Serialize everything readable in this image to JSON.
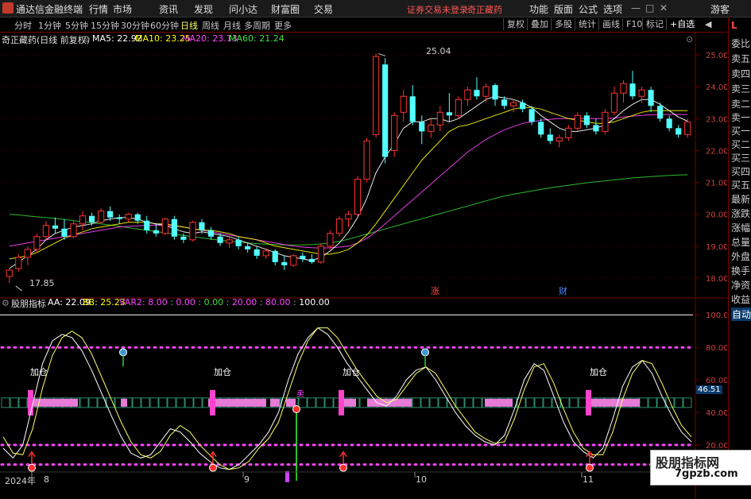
{
  "menubar": {
    "app_title": "通达信金融终端",
    "menus": [
      "行情",
      "市场",
      "资讯",
      "发现",
      "问小达",
      "财富圈",
      "交易"
    ],
    "alert_text": "证券交易未登录",
    "stock_name": "奇正藏药",
    "right_items": [
      "功能",
      "版面",
      "公式",
      "选项"
    ],
    "guest": "游客",
    "window_controls": [
      "—",
      "□",
      "✕"
    ]
  },
  "toolbar": {
    "tabs": [
      "分时",
      "1分钟",
      "5分钟",
      "15分钟",
      "30分钟",
      "60分钟",
      "日线",
      "周线",
      "月线",
      "多周期",
      "更多"
    ],
    "active_tab": "日线",
    "buttons": [
      "复权",
      "叠加",
      "多股",
      "统计",
      "画线",
      "F10",
      "标记",
      "+自选"
    ],
    "back_button": "◀"
  },
  "right_panel": {
    "top": "L",
    "items": [
      "委比",
      "卖五",
      "卖四",
      "卖三",
      "卖二",
      "卖一",
      "买一",
      "买二",
      "买三",
      "买四",
      "买五",
      "最新",
      "涨跌",
      "涨幅",
      "总量",
      "外盘",
      "换手",
      "净资",
      "收益"
    ],
    "auto_label": "自动"
  },
  "main_chart": {
    "title": "奇正藏药(日线 前复权)",
    "ma_labels": [
      {
        "label": "MA5: 22.92",
        "color": "#ffffff"
      },
      {
        "label": "MA10: 23.25",
        "color": "#ffff00"
      },
      {
        "label": "MA20: 23.13",
        "color": "#ff44ff"
      },
      {
        "label": "MA60: 21.24",
        "color": "#44dd44"
      }
    ],
    "high_label": "25.04",
    "low_label": "17.85",
    "marks": [
      {
        "text": "涨",
        "color": "#ff4444"
      },
      {
        "text": "财",
        "color": "#4488ff"
      }
    ]
  },
  "indicator": {
    "title": "股朋指标",
    "aa": "AA: 22.09",
    "bb": "BB: 25.23",
    "var_prefix": "VAR2: ",
    "var_values": [
      "8.00",
      "0.00",
      "0.00",
      "20.00",
      "80.00",
      "100.00"
    ],
    "var_colors": [
      "#ff44ff",
      "#ff44ff",
      "#44dd44",
      "#ff44ff",
      "#ff44ff",
      "#ffffff"
    ],
    "signal_labels": [
      "加仓",
      "加仓",
      "加仓",
      "加仓"
    ],
    "sell_label": "卖",
    "mid_value": "46.51"
  },
  "x_axis": [
    "2024年",
    "8",
    "9",
    "10",
    "11"
  ],
  "watermark": {
    "line1": "股朋指标网",
    "line2": "7gpzb.com"
  },
  "chart_data": [
    {
      "type": "candlestick",
      "title": "奇正藏药(日线 前复权)",
      "y_ticks": [
        18.0,
        19.0,
        20.0,
        21.0,
        22.0,
        23.0,
        24.0,
        25.0
      ],
      "ylim": [
        17.6,
        25.4
      ],
      "ma_series_names": [
        "MA5",
        "MA10",
        "MA20",
        "MA60"
      ],
      "candles": [
        {
          "o": 18.05,
          "h": 18.3,
          "l": 17.85,
          "c": 18.25
        },
        {
          "o": 18.3,
          "h": 18.75,
          "l": 18.2,
          "c": 18.65
        },
        {
          "o": 18.65,
          "h": 19.0,
          "l": 18.4,
          "c": 18.9
        },
        {
          "o": 18.9,
          "h": 19.4,
          "l": 18.8,
          "c": 19.3
        },
        {
          "o": 19.3,
          "h": 19.8,
          "l": 19.2,
          "c": 19.65
        },
        {
          "o": 19.65,
          "h": 19.9,
          "l": 19.4,
          "c": 19.55
        },
        {
          "o": 19.55,
          "h": 19.85,
          "l": 19.2,
          "c": 19.3
        },
        {
          "o": 19.3,
          "h": 19.8,
          "l": 19.25,
          "c": 19.7
        },
        {
          "o": 19.7,
          "h": 20.1,
          "l": 19.5,
          "c": 19.95
        },
        {
          "o": 19.95,
          "h": 20.05,
          "l": 19.65,
          "c": 19.75
        },
        {
          "o": 19.75,
          "h": 20.2,
          "l": 19.7,
          "c": 20.1
        },
        {
          "o": 20.1,
          "h": 20.25,
          "l": 19.8,
          "c": 19.9
        },
        {
          "o": 19.9,
          "h": 20.0,
          "l": 19.7,
          "c": 19.85
        },
        {
          "o": 19.85,
          "h": 20.05,
          "l": 19.75,
          "c": 20.0
        },
        {
          "o": 20.0,
          "h": 20.05,
          "l": 19.7,
          "c": 19.8
        },
        {
          "o": 19.8,
          "h": 19.95,
          "l": 19.4,
          "c": 19.5
        },
        {
          "o": 19.5,
          "h": 19.7,
          "l": 19.3,
          "c": 19.4
        },
        {
          "o": 19.4,
          "h": 19.9,
          "l": 19.35,
          "c": 19.85
        },
        {
          "o": 19.85,
          "h": 19.95,
          "l": 19.2,
          "c": 19.3
        },
        {
          "o": 19.3,
          "h": 19.4,
          "l": 19.1,
          "c": 19.2
        },
        {
          "o": 19.2,
          "h": 19.8,
          "l": 19.15,
          "c": 19.75
        },
        {
          "o": 19.75,
          "h": 19.85,
          "l": 19.4,
          "c": 19.5
        },
        {
          "o": 19.5,
          "h": 19.6,
          "l": 19.2,
          "c": 19.3
        },
        {
          "o": 19.3,
          "h": 19.4,
          "l": 19.0,
          "c": 19.1
        },
        {
          "o": 19.1,
          "h": 19.3,
          "l": 18.95,
          "c": 19.2
        },
        {
          "o": 19.2,
          "h": 19.3,
          "l": 18.9,
          "c": 19.0
        },
        {
          "o": 19.0,
          "h": 19.1,
          "l": 18.8,
          "c": 18.9
        },
        {
          "o": 18.9,
          "h": 19.0,
          "l": 18.6,
          "c": 18.7
        },
        {
          "o": 18.7,
          "h": 18.95,
          "l": 18.6,
          "c": 18.85
        },
        {
          "o": 18.85,
          "h": 18.9,
          "l": 18.4,
          "c": 18.5
        },
        {
          "o": 18.5,
          "h": 18.7,
          "l": 18.25,
          "c": 18.4
        },
        {
          "o": 18.4,
          "h": 18.75,
          "l": 18.35,
          "c": 18.7
        },
        {
          "o": 18.7,
          "h": 18.8,
          "l": 18.5,
          "c": 18.6
        },
        {
          "o": 18.6,
          "h": 18.75,
          "l": 18.45,
          "c": 18.5
        },
        {
          "o": 18.5,
          "h": 19.1,
          "l": 18.45,
          "c": 19.0
        },
        {
          "o": 19.0,
          "h": 19.5,
          "l": 18.9,
          "c": 19.4
        },
        {
          "o": 19.4,
          "h": 19.95,
          "l": 19.3,
          "c": 19.85
        },
        {
          "o": 19.85,
          "h": 20.1,
          "l": 19.6,
          "c": 20.0
        },
        {
          "o": 20.0,
          "h": 21.2,
          "l": 19.9,
          "c": 21.1
        },
        {
          "o": 21.1,
          "h": 22.4,
          "l": 21.0,
          "c": 22.3
        },
        {
          "o": 22.5,
          "h": 25.04,
          "l": 22.4,
          "c": 24.95
        },
        {
          "o": 24.7,
          "h": 24.9,
          "l": 21.6,
          "c": 21.8
        },
        {
          "o": 22.0,
          "h": 23.2,
          "l": 21.8,
          "c": 23.1
        },
        {
          "o": 23.2,
          "h": 23.9,
          "l": 22.9,
          "c": 23.7
        },
        {
          "o": 23.7,
          "h": 24.05,
          "l": 22.8,
          "c": 22.9
        },
        {
          "o": 22.9,
          "h": 23.1,
          "l": 22.2,
          "c": 22.6
        },
        {
          "o": 22.6,
          "h": 23.0,
          "l": 22.4,
          "c": 22.8
        },
        {
          "o": 22.8,
          "h": 23.4,
          "l": 22.6,
          "c": 23.2
        },
        {
          "o": 23.2,
          "h": 23.8,
          "l": 22.9,
          "c": 23.1
        },
        {
          "o": 23.1,
          "h": 23.7,
          "l": 23.0,
          "c": 23.6
        },
        {
          "o": 23.6,
          "h": 24.0,
          "l": 23.4,
          "c": 23.9
        },
        {
          "o": 23.9,
          "h": 24.3,
          "l": 23.6,
          "c": 23.7
        },
        {
          "o": 23.7,
          "h": 24.1,
          "l": 23.5,
          "c": 24.0
        },
        {
          "o": 24.05,
          "h": 24.1,
          "l": 23.4,
          "c": 23.6
        },
        {
          "o": 23.6,
          "h": 23.7,
          "l": 23.3,
          "c": 23.4
        },
        {
          "o": 23.4,
          "h": 23.6,
          "l": 23.2,
          "c": 23.5
        },
        {
          "o": 23.5,
          "h": 23.6,
          "l": 23.2,
          "c": 23.3
        },
        {
          "o": 23.3,
          "h": 23.4,
          "l": 22.8,
          "c": 22.9
        },
        {
          "o": 22.9,
          "h": 23.0,
          "l": 22.4,
          "c": 22.5
        },
        {
          "o": 22.5,
          "h": 22.7,
          "l": 22.2,
          "c": 22.3
        },
        {
          "o": 22.3,
          "h": 22.5,
          "l": 22.1,
          "c": 22.4
        },
        {
          "o": 22.4,
          "h": 22.8,
          "l": 22.3,
          "c": 22.7
        },
        {
          "o": 22.7,
          "h": 23.2,
          "l": 22.6,
          "c": 23.1
        },
        {
          "o": 23.1,
          "h": 23.2,
          "l": 22.7,
          "c": 22.8
        },
        {
          "o": 22.8,
          "h": 23.0,
          "l": 22.5,
          "c": 22.6
        },
        {
          "o": 22.6,
          "h": 23.3,
          "l": 22.5,
          "c": 23.2
        },
        {
          "o": 23.2,
          "h": 24.0,
          "l": 23.1,
          "c": 23.8
        },
        {
          "o": 23.8,
          "h": 24.2,
          "l": 23.5,
          "c": 24.1
        },
        {
          "o": 24.1,
          "h": 24.5,
          "l": 23.6,
          "c": 23.7
        },
        {
          "o": 23.7,
          "h": 24.0,
          "l": 23.5,
          "c": 23.9
        },
        {
          "o": 23.9,
          "h": 24.0,
          "l": 23.2,
          "c": 23.4
        },
        {
          "o": 23.4,
          "h": 23.5,
          "l": 22.9,
          "c": 23.0
        },
        {
          "o": 23.0,
          "h": 23.1,
          "l": 22.6,
          "c": 22.7
        },
        {
          "o": 22.7,
          "h": 22.8,
          "l": 22.4,
          "c": 22.5
        },
        {
          "o": 22.5,
          "h": 23.0,
          "l": 22.4,
          "c": 22.9
        }
      ],
      "ma5": [
        18.3,
        18.5,
        18.7,
        18.9,
        19.2,
        19.4,
        19.5,
        19.6,
        19.65,
        19.7,
        19.8,
        19.85,
        19.9,
        19.9,
        19.85,
        19.75,
        19.7,
        19.65,
        19.55,
        19.45,
        19.4,
        19.45,
        19.4,
        19.35,
        19.3,
        19.2,
        19.1,
        19.0,
        18.9,
        18.8,
        18.7,
        18.65,
        18.6,
        18.55,
        18.65,
        18.85,
        19.1,
        19.45,
        19.9,
        20.5,
        21.3,
        21.8,
        22.2,
        22.7,
        22.9,
        22.9,
        23.0,
        23.0,
        22.9,
        23.0,
        23.2,
        23.4,
        23.6,
        23.7,
        23.65,
        23.6,
        23.5,
        23.35,
        23.1,
        22.9,
        22.7,
        22.6,
        22.6,
        22.65,
        22.7,
        22.8,
        23.0,
        23.25,
        23.45,
        23.6,
        23.6,
        23.45,
        23.25,
        23.05,
        22.92
      ],
      "ma10": [
        18.6,
        18.65,
        18.7,
        18.8,
        18.95,
        19.1,
        19.25,
        19.35,
        19.45,
        19.55,
        19.6,
        19.65,
        19.7,
        19.75,
        19.75,
        19.75,
        19.7,
        19.7,
        19.65,
        19.6,
        19.55,
        19.5,
        19.5,
        19.45,
        19.4,
        19.3,
        19.25,
        19.2,
        19.1,
        19.0,
        18.95,
        18.9,
        18.85,
        18.8,
        18.75,
        18.75,
        18.8,
        18.9,
        19.1,
        19.35,
        19.7,
        20.1,
        20.5,
        20.9,
        21.3,
        21.7,
        22.0,
        22.3,
        22.6,
        22.75,
        22.8,
        22.9,
        23.0,
        23.1,
        23.2,
        23.3,
        23.35,
        23.35,
        23.3,
        23.2,
        23.1,
        23.0,
        22.95,
        22.9,
        22.85,
        22.85,
        22.9,
        23.0,
        23.1,
        23.2,
        23.25,
        23.25,
        23.25,
        23.25,
        23.25
      ],
      "ma20": [
        19.0,
        19.05,
        19.1,
        19.15,
        19.2,
        19.25,
        19.3,
        19.35,
        19.4,
        19.45,
        19.5,
        19.55,
        19.6,
        19.62,
        19.64,
        19.65,
        19.66,
        19.65,
        19.63,
        19.6,
        19.55,
        19.5,
        19.45,
        19.4,
        19.35,
        19.3,
        19.25,
        19.2,
        19.15,
        19.1,
        19.05,
        19.0,
        18.97,
        18.95,
        18.94,
        18.95,
        18.97,
        19.0,
        19.1,
        19.25,
        19.45,
        19.7,
        19.95,
        20.2,
        20.45,
        20.7,
        20.95,
        21.2,
        21.45,
        21.7,
        21.95,
        22.15,
        22.35,
        22.5,
        22.65,
        22.75,
        22.85,
        22.9,
        22.95,
        22.98,
        23.0,
        23.0,
        23.0,
        23.0,
        23.0,
        23.0,
        23.02,
        23.05,
        23.08,
        23.1,
        23.12,
        23.13,
        23.13,
        23.13,
        23.13
      ],
      "ma60": [
        20.0,
        19.98,
        19.95,
        19.92,
        19.9,
        19.87,
        19.84,
        19.8,
        19.77,
        19.73,
        19.7,
        19.66,
        19.62,
        19.58,
        19.54,
        19.5,
        19.46,
        19.42,
        19.38,
        19.34,
        19.3,
        19.26,
        19.22,
        19.19,
        19.16,
        19.13,
        19.1,
        19.08,
        19.06,
        19.05,
        19.04,
        19.04,
        19.04,
        19.05,
        19.07,
        19.1,
        19.15,
        19.22,
        19.3,
        19.38,
        19.46,
        19.54,
        19.62,
        19.7,
        19.78,
        19.86,
        19.94,
        20.02,
        20.1,
        20.18,
        20.26,
        20.34,
        20.42,
        20.5,
        20.57,
        20.63,
        20.68,
        20.73,
        20.78,
        20.83,
        20.87,
        20.91,
        20.95,
        20.99,
        21.02,
        21.05,
        21.08,
        21.11,
        21.14,
        21.16,
        21.18,
        21.2,
        21.22,
        21.23,
        21.24
      ]
    },
    {
      "type": "line",
      "title": "股朋指标",
      "y_ticks": [
        20.0,
        40.0,
        60.0,
        80.0,
        100.0
      ],
      "ylim": [
        0,
        105
      ],
      "series": [
        {
          "name": "AA",
          "values": [
            18,
            12,
            20,
            45,
            70,
            84,
            88,
            86,
            78,
            66,
            52,
            38,
            25,
            15,
            12,
            14,
            22,
            30,
            28,
            22,
            15,
            10,
            6,
            5,
            8,
            14,
            20,
            28,
            40,
            60,
            76,
            86,
            92,
            88,
            80,
            70,
            62,
            54,
            46,
            44,
            50,
            60,
            66,
            68,
            60,
            50,
            40,
            32,
            26,
            22,
            20,
            26,
            42,
            60,
            70,
            66,
            50,
            34,
            22,
            16,
            12,
            18,
            36,
            56,
            68,
            72,
            64,
            50,
            38,
            28,
            22
          ]
        },
        {
          "name": "BB",
          "values": [
            25,
            15,
            14,
            30,
            55,
            75,
            86,
            90,
            86,
            76,
            62,
            48,
            34,
            22,
            14,
            12,
            16,
            26,
            32,
            28,
            20,
            14,
            8,
            5,
            6,
            10,
            18,
            24,
            34,
            52,
            70,
            84,
            92,
            92,
            86,
            76,
            66,
            58,
            50,
            46,
            48,
            56,
            64,
            68,
            64,
            54,
            44,
            36,
            28,
            24,
            21,
            22,
            36,
            54,
            68,
            70,
            58,
            42,
            28,
            18,
            14,
            14,
            28,
            48,
            64,
            72,
            70,
            58,
            44,
            32,
            25
          ]
        }
      ]
    }
  ]
}
